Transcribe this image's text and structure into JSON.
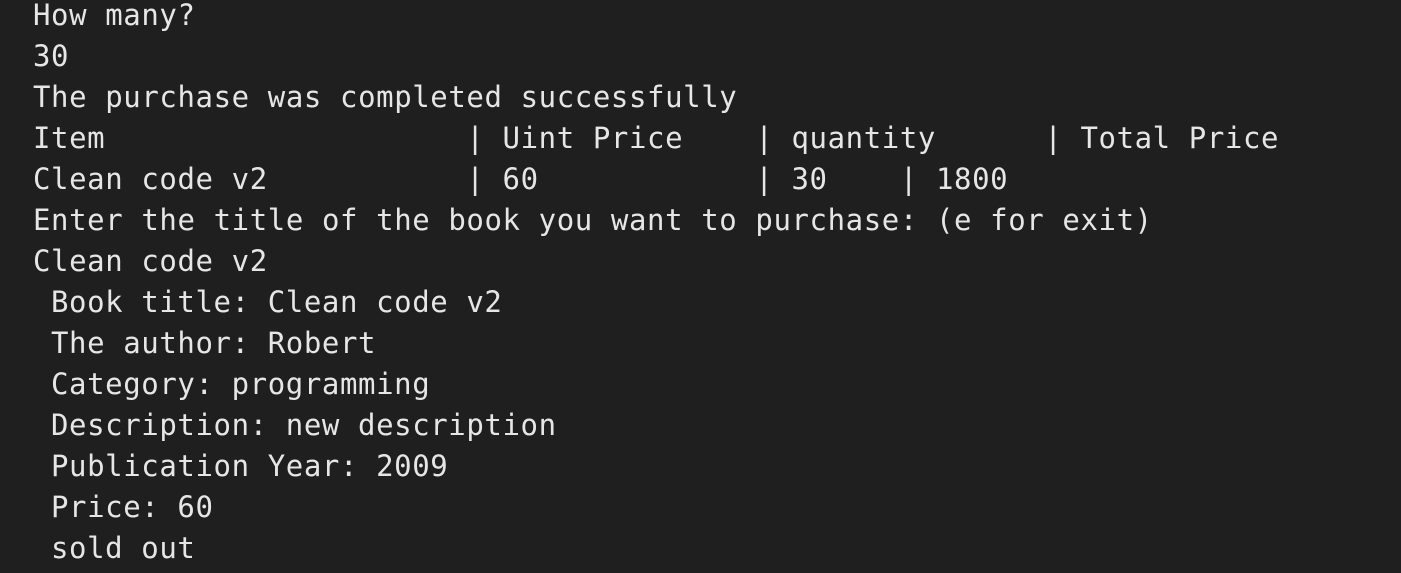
{
  "terminal": {
    "lines": [
      "How many?",
      "30",
      "The purchase was completed successfully",
      "Item                    | Uint Price    | quantity      | Total Price",
      "Clean code v2           | 60            | 30    | 1800",
      "Enter the title of the book you want to purchase: (e for exit)",
      "Clean code v2"
    ],
    "book_details": [
      "Book title: Clean code v2",
      "The author: Robert",
      "Category: programming",
      "Description: new description",
      "Publication Year: 2009",
      "Price: 60",
      "sold out"
    ]
  }
}
